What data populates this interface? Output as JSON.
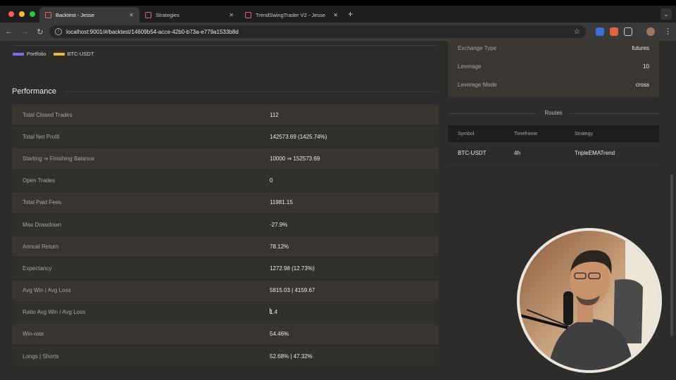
{
  "browser": {
    "tabs": [
      {
        "title": "Backtest - Jesse",
        "active": true
      },
      {
        "title": "Strategies",
        "active": false
      },
      {
        "title": "TrendSwingTrader V2 - Jesse",
        "active": false
      }
    ],
    "new_tab": "+",
    "menu_glyph": "⌄",
    "url": "localhost:9001/#/backtest/14609b54-acce-42b0-b73a-e779a1533b8d",
    "back_glyph": "←",
    "forward_glyph": "→",
    "reload_glyph": "↻",
    "star_glyph": "☆",
    "more_glyph": "⋮"
  },
  "legend": [
    {
      "label": "Portfolio",
      "color": "#7b6ff0"
    },
    {
      "label": "BTC-USDT",
      "color": "#f0b731"
    }
  ],
  "performance": {
    "title": "Performance",
    "rows": [
      {
        "key": "Total Closed Trades",
        "value": "112"
      },
      {
        "key": "Total Net Profit",
        "value": "142573.69 (1425.74%)"
      },
      {
        "key": "Starting ⇒ Finishing Balance",
        "value": "10000 ⇒ 152573.69"
      },
      {
        "key": "Open Trades",
        "value": "0"
      },
      {
        "key": "Total Paid Fees",
        "value": "11981.15"
      },
      {
        "key": "Max Drawdown",
        "value": "-27.9%"
      },
      {
        "key": "Annual Return",
        "value": "78.12%"
      },
      {
        "key": "Expectancy",
        "value": "1272.98 (12.73%)"
      },
      {
        "key": "Avg Win | Avg Loss",
        "value": "5815.03 | 4159.67"
      },
      {
        "key": "Ratio Avg Win / Avg Loss",
        "value": "1.4"
      },
      {
        "key": "Win-rate",
        "value": "54.46%"
      },
      {
        "key": "Longs | Shorts",
        "value": "52.68% | 47.32%"
      }
    ]
  },
  "settings": {
    "rows": [
      {
        "key": "Exchange Type",
        "value": "futures"
      },
      {
        "key": "Leverage",
        "value": "10"
      },
      {
        "key": "Leverage Mode",
        "value": "cross"
      }
    ]
  },
  "routes": {
    "title": "Routes",
    "headers": [
      "Symbol",
      "Timeframe",
      "Strategy"
    ],
    "rows": [
      {
        "symbol": "BTC-USDT",
        "timeframe": "4h",
        "strategy": "TripleEMATrend"
      }
    ]
  }
}
